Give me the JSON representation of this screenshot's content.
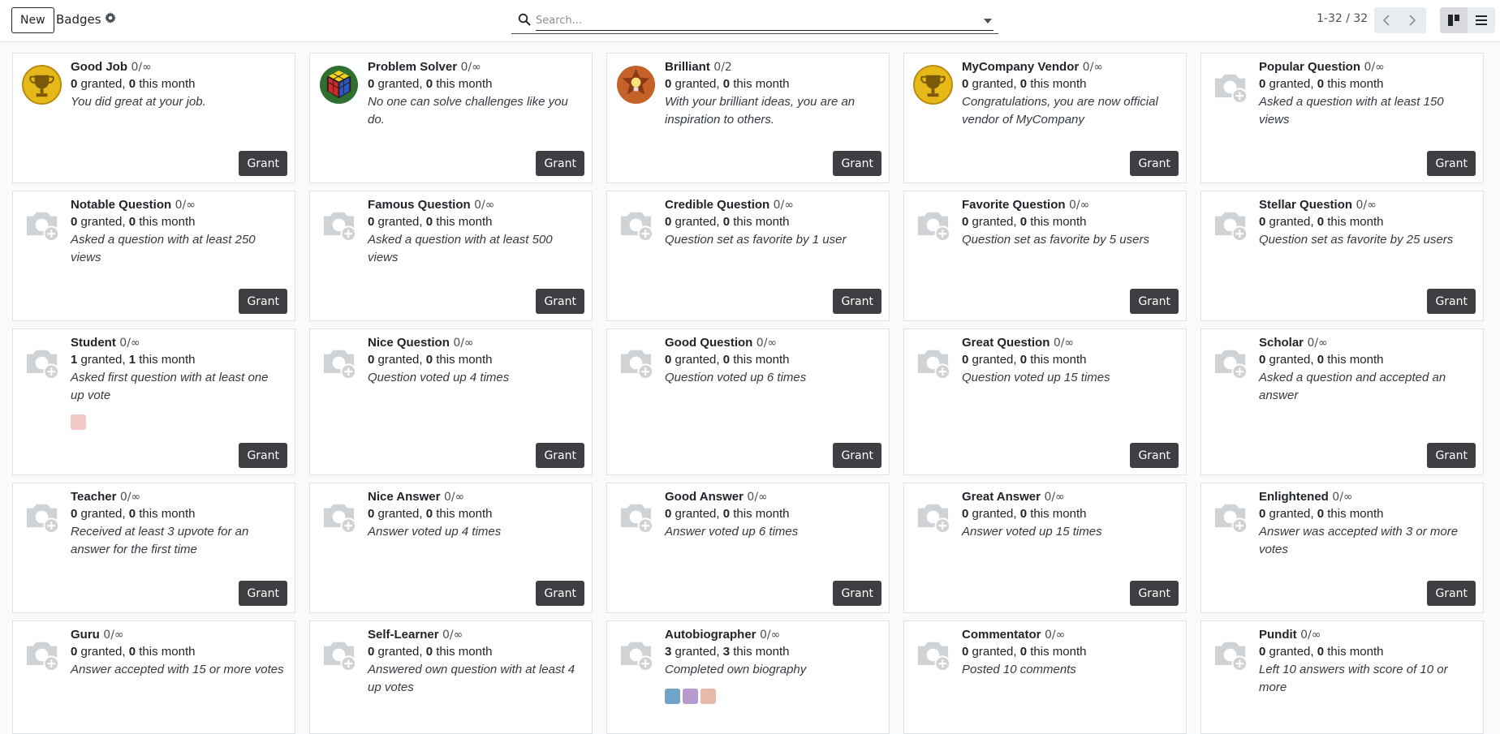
{
  "toolbar": {
    "new_label": "New",
    "title": "Badges",
    "search_placeholder": "Search...",
    "pager": "1-32 / 32"
  },
  "icons": {
    "gear": "gear-icon",
    "search": "search-icon",
    "prev": "chevron-left-icon",
    "next": "chevron-right-icon",
    "kanban": "kanban-view-icon",
    "list": "list-view-icon",
    "placeholder": "camera-plus-icon"
  },
  "colors": {
    "grant_button": "#3d3f42",
    "placeholder_icon": "#d0d3d6"
  },
  "grant_label": "Grant",
  "granted_word": "granted,",
  "month_word": "this month",
  "cards": [
    {
      "name": "Good Job",
      "limit": "0/∞",
      "granted": "0",
      "month": "0",
      "desc": "You did great at your job.",
      "image": "gold-trophy"
    },
    {
      "name": "Problem Solver",
      "limit": "0/∞",
      "granted": "0",
      "month": "0",
      "desc": "No one can solve challenges like you do.",
      "image": "rubiks-cube"
    },
    {
      "name": "Brilliant",
      "limit": "0/2",
      "granted": "0",
      "month": "0",
      "desc": "With your brilliant ideas, you are an inspiration to others.",
      "image": "lightbulb-star"
    },
    {
      "name": "MyCompany Vendor",
      "limit": "0/∞",
      "granted": "0",
      "month": "0",
      "desc": "Congratulations, you are now official vendor of MyCompany",
      "image": "gold-trophy"
    },
    {
      "name": "Popular Question",
      "limit": "0/∞",
      "granted": "0",
      "month": "0",
      "desc": "Asked a question with at least 150 views",
      "image": "placeholder"
    },
    {
      "name": "Notable Question",
      "limit": "0/∞",
      "granted": "0",
      "month": "0",
      "desc": "Asked a question with at least 250 views",
      "image": "placeholder"
    },
    {
      "name": "Famous Question",
      "limit": "0/∞",
      "granted": "0",
      "month": "0",
      "desc": "Asked a question with at least 500 views",
      "image": "placeholder"
    },
    {
      "name": "Credible Question",
      "limit": "0/∞",
      "granted": "0",
      "month": "0",
      "desc": "Question set as favorite by 1 user",
      "image": "placeholder"
    },
    {
      "name": "Favorite Question",
      "limit": "0/∞",
      "granted": "0",
      "month": "0",
      "desc": "Question set as favorite by 5 users",
      "image": "placeholder"
    },
    {
      "name": "Stellar Question",
      "limit": "0/∞",
      "granted": "0",
      "month": "0",
      "desc": "Question set as favorite by 25 users",
      "image": "placeholder"
    },
    {
      "name": "Student",
      "limit": "0/∞",
      "granted": "1",
      "month": "1",
      "desc": "Asked first question with at least one up vote",
      "image": "placeholder",
      "owners": [
        "#f2c9c4"
      ]
    },
    {
      "name": "Nice Question",
      "limit": "0/∞",
      "granted": "0",
      "month": "0",
      "desc": "Question voted up 4 times",
      "image": "placeholder"
    },
    {
      "name": "Good Question",
      "limit": "0/∞",
      "granted": "0",
      "month": "0",
      "desc": "Question voted up 6 times",
      "image": "placeholder"
    },
    {
      "name": "Great Question",
      "limit": "0/∞",
      "granted": "0",
      "month": "0",
      "desc": "Question voted up 15 times",
      "image": "placeholder"
    },
    {
      "name": "Scholar",
      "limit": "0/∞",
      "granted": "0",
      "month": "0",
      "desc": "Asked a question and accepted an answer",
      "image": "placeholder"
    },
    {
      "name": "Teacher",
      "limit": "0/∞",
      "granted": "0",
      "month": "0",
      "desc": "Received at least 3 upvote for an answer for the first time",
      "image": "placeholder"
    },
    {
      "name": "Nice Answer",
      "limit": "0/∞",
      "granted": "0",
      "month": "0",
      "desc": "Answer voted up 4 times",
      "image": "placeholder"
    },
    {
      "name": "Good Answer",
      "limit": "0/∞",
      "granted": "0",
      "month": "0",
      "desc": "Answer voted up 6 times",
      "image": "placeholder"
    },
    {
      "name": "Great Answer",
      "limit": "0/∞",
      "granted": "0",
      "month": "0",
      "desc": "Answer voted up 15 times",
      "image": "placeholder"
    },
    {
      "name": "Enlightened",
      "limit": "0/∞",
      "granted": "0",
      "month": "0",
      "desc": "Answer was accepted with 3 or more votes",
      "image": "placeholder"
    },
    {
      "name": "Guru",
      "limit": "0/∞",
      "granted": "0",
      "month": "0",
      "desc": "Answer accepted with 15 or more votes",
      "image": "placeholder"
    },
    {
      "name": "Self-Learner",
      "limit": "0/∞",
      "granted": "0",
      "month": "0",
      "desc": "Answered own question with at least 4 up votes",
      "image": "placeholder"
    },
    {
      "name": "Autobiographer",
      "limit": "0/∞",
      "granted": "3",
      "month": "3",
      "desc": "Completed own biography",
      "image": "placeholder",
      "owners": [
        "#6fa3c7",
        "#b79ad0",
        "#e7b9a9"
      ]
    },
    {
      "name": "Commentator",
      "limit": "0/∞",
      "granted": "0",
      "month": "0",
      "desc": "Posted 10 comments",
      "image": "placeholder"
    },
    {
      "name": "Pundit",
      "limit": "0/∞",
      "granted": "0",
      "month": "0",
      "desc": "Left 10 answers with score of 10 or more",
      "image": "placeholder"
    }
  ]
}
